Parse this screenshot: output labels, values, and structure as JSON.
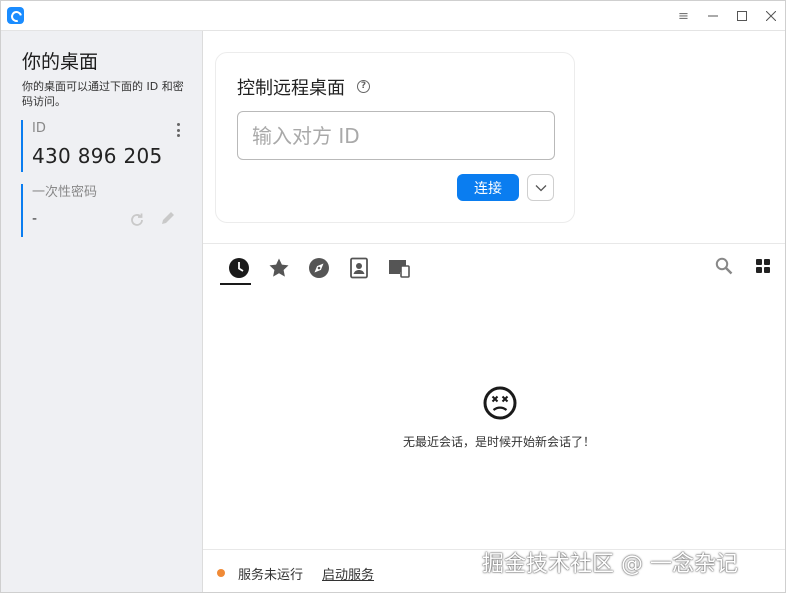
{
  "window": {
    "minimize_glyph": "—",
    "maximize_glyph": "☐",
    "close_glyph": "✕",
    "menu_glyph": "≡"
  },
  "left": {
    "title": "你的桌面",
    "description": "你的桌面可以通过下面的 ID 和密码访问。",
    "id_label": "ID",
    "id_value": "430 896 205",
    "password_label": "一次性密码",
    "password_value": "-"
  },
  "connect": {
    "title": "控制远程桌面",
    "input_placeholder": "输入对方 ID",
    "input_value": "",
    "connect_label": "连接"
  },
  "tabs": [
    {
      "name": "recent",
      "icon": "clock-icon",
      "active": true
    },
    {
      "name": "favorites",
      "icon": "star-icon",
      "active": false
    },
    {
      "name": "discovered",
      "icon": "compass-icon",
      "active": false
    },
    {
      "name": "address-book",
      "icon": "address-book-icon",
      "active": false
    },
    {
      "name": "group",
      "icon": "devices-icon",
      "active": false
    }
  ],
  "empty": {
    "icon": "dizzy-face-icon",
    "message": "无最近会话，是时候开始新会话了！"
  },
  "status": {
    "text": "服务未运行",
    "start_link": "启动服务",
    "dot_color": "#f08a36"
  },
  "colors": {
    "accent": "#0a7df0"
  },
  "watermark": "掘金技术社区 @ 一念杂记"
}
